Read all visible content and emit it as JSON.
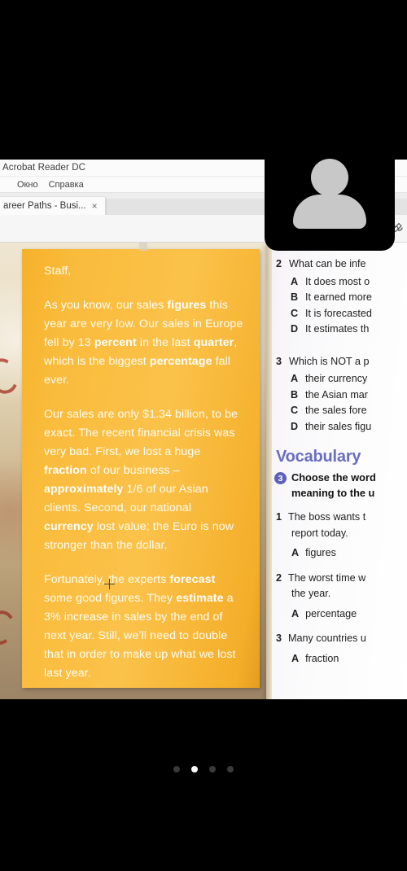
{
  "app": {
    "title": "Acrobat Reader DC",
    "menu": [
      "Окно",
      "Справка"
    ],
    "tab": {
      "label": "areer Paths - Busi...",
      "close": "×"
    },
    "toolbar": {
      "prev_page_icon": "arrow-up-circle-icon",
      "next_page_icon": "arrow-down-circle-icon",
      "sign_icon": "sign-pen-icon"
    }
  },
  "document": {
    "left_page": {
      "salutation": "Staff,",
      "paragraphs": [
        {
          "runs": [
            {
              "t": "As you know, our sales "
            },
            {
              "t": "figures",
              "b": true
            },
            {
              "t": " this year are very low. Our sales in Europe fell by 13 "
            },
            {
              "t": "percent",
              "b": true
            },
            {
              "t": " in the last "
            },
            {
              "t": "quarter",
              "b": true
            },
            {
              "t": ", which is the biggest "
            },
            {
              "t": "percentage",
              "b": true
            },
            {
              "t": " fall ever."
            }
          ]
        },
        {
          "runs": [
            {
              "t": "Our sales are only $1.34 billion, to be exact. The recent financial crisis was very bad. First, we lost a huge "
            },
            {
              "t": "fraction",
              "b": true
            },
            {
              "t": " of our business – "
            },
            {
              "t": "approximately",
              "b": true
            },
            {
              "t": " 1/6 of our Asian clients. Second, our national "
            },
            {
              "t": "currency",
              "b": true
            },
            {
              "t": " lost value; the Euro is now stronger than the dollar."
            }
          ]
        },
        {
          "runs": [
            {
              "t": "Fortunately, the experts "
            },
            {
              "t": "forecast",
              "b": true
            },
            {
              "t": " some good figures. They "
            },
            {
              "t": "estimate",
              "b": true
            },
            {
              "t": " a 3% increase in sales by the end of next year. Still, we’ll need to double that in order to make up what we lost last year."
            }
          ]
        }
      ]
    },
    "right_page": {
      "question_2": {
        "stem": "What can be infe",
        "options": [
          {
            "letter": "A",
            "text": "It does most o"
          },
          {
            "letter": "B",
            "text": "It earned more"
          },
          {
            "letter": "C",
            "text": "It is forecasted"
          },
          {
            "letter": "D",
            "text": "It estimates th"
          }
        ]
      },
      "question_3": {
        "number": "3",
        "stem": "Which is NOT a p",
        "options": [
          {
            "letter": "A",
            "text": "their currency"
          },
          {
            "letter": "B",
            "text": "the Asian mar"
          },
          {
            "letter": "C",
            "text": "the sales fore"
          },
          {
            "letter": "D",
            "text": "their sales figu"
          }
        ]
      },
      "vocabulary": {
        "heading": "Vocabulary",
        "exercise_number": "3",
        "instruction_line1": "Choose the word",
        "instruction_line2": "meaning to the u",
        "items": [
          {
            "number": "1",
            "stem_line1": "The boss wants t",
            "stem_line2": "report today.",
            "option_letter": "A",
            "option_text": "figures"
          },
          {
            "number": "2",
            "stem_line1": "The worst time w",
            "stem_line2": "the year.",
            "option_letter": "A",
            "option_text": "percentage"
          },
          {
            "number": "3",
            "stem_line1": "Many countries u",
            "stem_line2": "",
            "option_letter": "A",
            "option_text": "fraction"
          }
        ]
      }
    }
  },
  "overlay": {
    "avatar_icon": "person-avatar-icon"
  },
  "pager": {
    "total": 4,
    "active_index": 1
  },
  "colors": {
    "page_orange": "#f9bb3b",
    "vocab_purple": "#6a6ec0",
    "badge_purple": "#5d62b5",
    "letterbox": "#000000",
    "dot_active": "#ffffff",
    "dot_inactive": "#3a3a3a"
  }
}
